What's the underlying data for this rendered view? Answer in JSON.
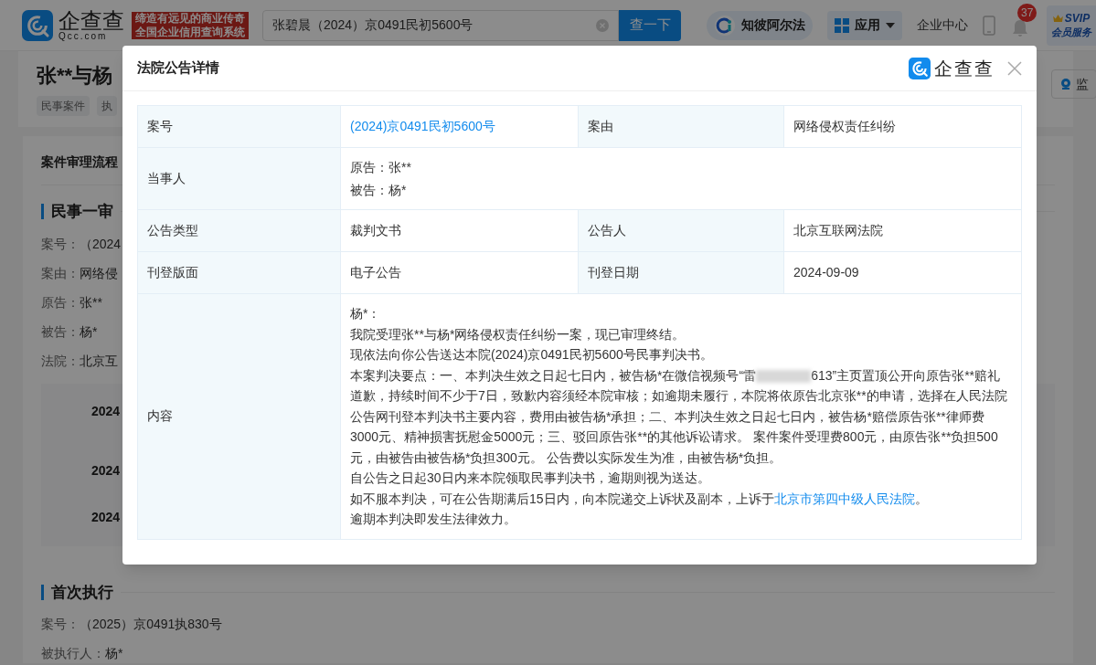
{
  "header": {
    "logo": "企查查",
    "logo_sub": "Qcc.com",
    "slogan": [
      "缔造有远见的商业传奇",
      "全国企业信用查询系统"
    ],
    "search": {
      "value": "张碧晨（2024）京0491民初5600号",
      "button": "查一下"
    },
    "nav": [
      {
        "kind": "pill",
        "label": "知彼阿尔法"
      },
      {
        "kind": "menu",
        "label": "应用"
      },
      {
        "kind": "link",
        "label": "企业中心"
      },
      {
        "kind": "phone"
      },
      {
        "kind": "bell",
        "badge": "37"
      },
      {
        "kind": "vip",
        "label": "SVIP",
        "sub": "会员服务"
      }
    ]
  },
  "page": {
    "title": "张**与杨",
    "tags": [
      "民事案件",
      "执"
    ],
    "monitor": "监",
    "process_title": "案件审理流程",
    "sections": [
      {
        "title": "民事一审",
        "fields": [
          {
            "label": "案号：",
            "value": "（2024"
          },
          {
            "label": "案由：",
            "value": "网络侵"
          },
          {
            "label": "原告：",
            "value": "张**"
          },
          {
            "label": "被告：",
            "value": "杨*"
          },
          {
            "label": "法院：",
            "value": "北京互"
          }
        ],
        "timeline": [
          "2024",
          "2024",
          "2024"
        ]
      },
      {
        "title": "首次执行",
        "fields": [
          {
            "label": "案号：",
            "value": "（2025）京0491执830号"
          },
          {
            "label": "被执行人：",
            "value": "杨*"
          }
        ]
      }
    ]
  },
  "modal": {
    "title": "法院公告详情",
    "brand": "企查查",
    "rows": [
      [
        {
          "label": "案号",
          "value": "(2024)京0491民初5600号",
          "link": true
        },
        {
          "label": "案由",
          "value": "网络侵权责任纠纷",
          "link": false
        }
      ],
      [
        {
          "label": "当事人",
          "lines": [
            "原告：张**",
            "被告：杨*"
          ]
        }
      ],
      [
        {
          "label": "公告类型",
          "value": "裁判文书",
          "link": false
        },
        {
          "label": "公告人",
          "value": "北京互联网法院",
          "link": false
        }
      ],
      [
        {
          "label": "刊登版面",
          "value": "电子公告",
          "link": false
        },
        {
          "label": "刊登日期",
          "value": "2024-09-09",
          "link": false
        }
      ]
    ],
    "content_label": "内容",
    "content": [
      {
        "kind": "text",
        "text": "杨*："
      },
      {
        "kind": "text",
        "text": "我院受理张**与杨*网络侵权责任纠纷一案，现已审理终结。"
      },
      {
        "kind": "text",
        "text": "现依法向你公告送达本院(2024)京0491民初5600号民事判决书。"
      },
      {
        "kind": "redacted",
        "before": "本案判决要点：一、本判决生效之日起七日内，被告杨*在微信视频号“雷",
        "after": "613”主页置顶公开向原告张**赔礼道歉，持续时间不少于7日，致歉内容须经本院审核；如逾期未履行，本院将依原告北京张**的申请，选择在人民法院公告网刊登本判决书主要内容，费用由被告杨*承担；二、本判决生效之日起七日内，被告杨*赔偿原告张**律师费3000元、精神损害抚慰金5000元；三、驳回原告张**的其他诉讼请求。 案件案件受理费800元，由原告张**负担500元，由被告由被告杨*负担300元。 公告费以实际发生为准，由被告杨*负担。"
      },
      {
        "kind": "text",
        "text": "自公告之日起30日内来本院领取民事判决书，逾期则视为送达。"
      },
      {
        "kind": "link",
        "before": "如不服本判决，可在公告期满后15日内，向本院递交上诉状及副本，上诉于",
        "link": "北京市第四中级人民法院",
        "after": "。"
      },
      {
        "kind": "text",
        "text": "逾期本判决即发生法律效力。"
      }
    ]
  }
}
